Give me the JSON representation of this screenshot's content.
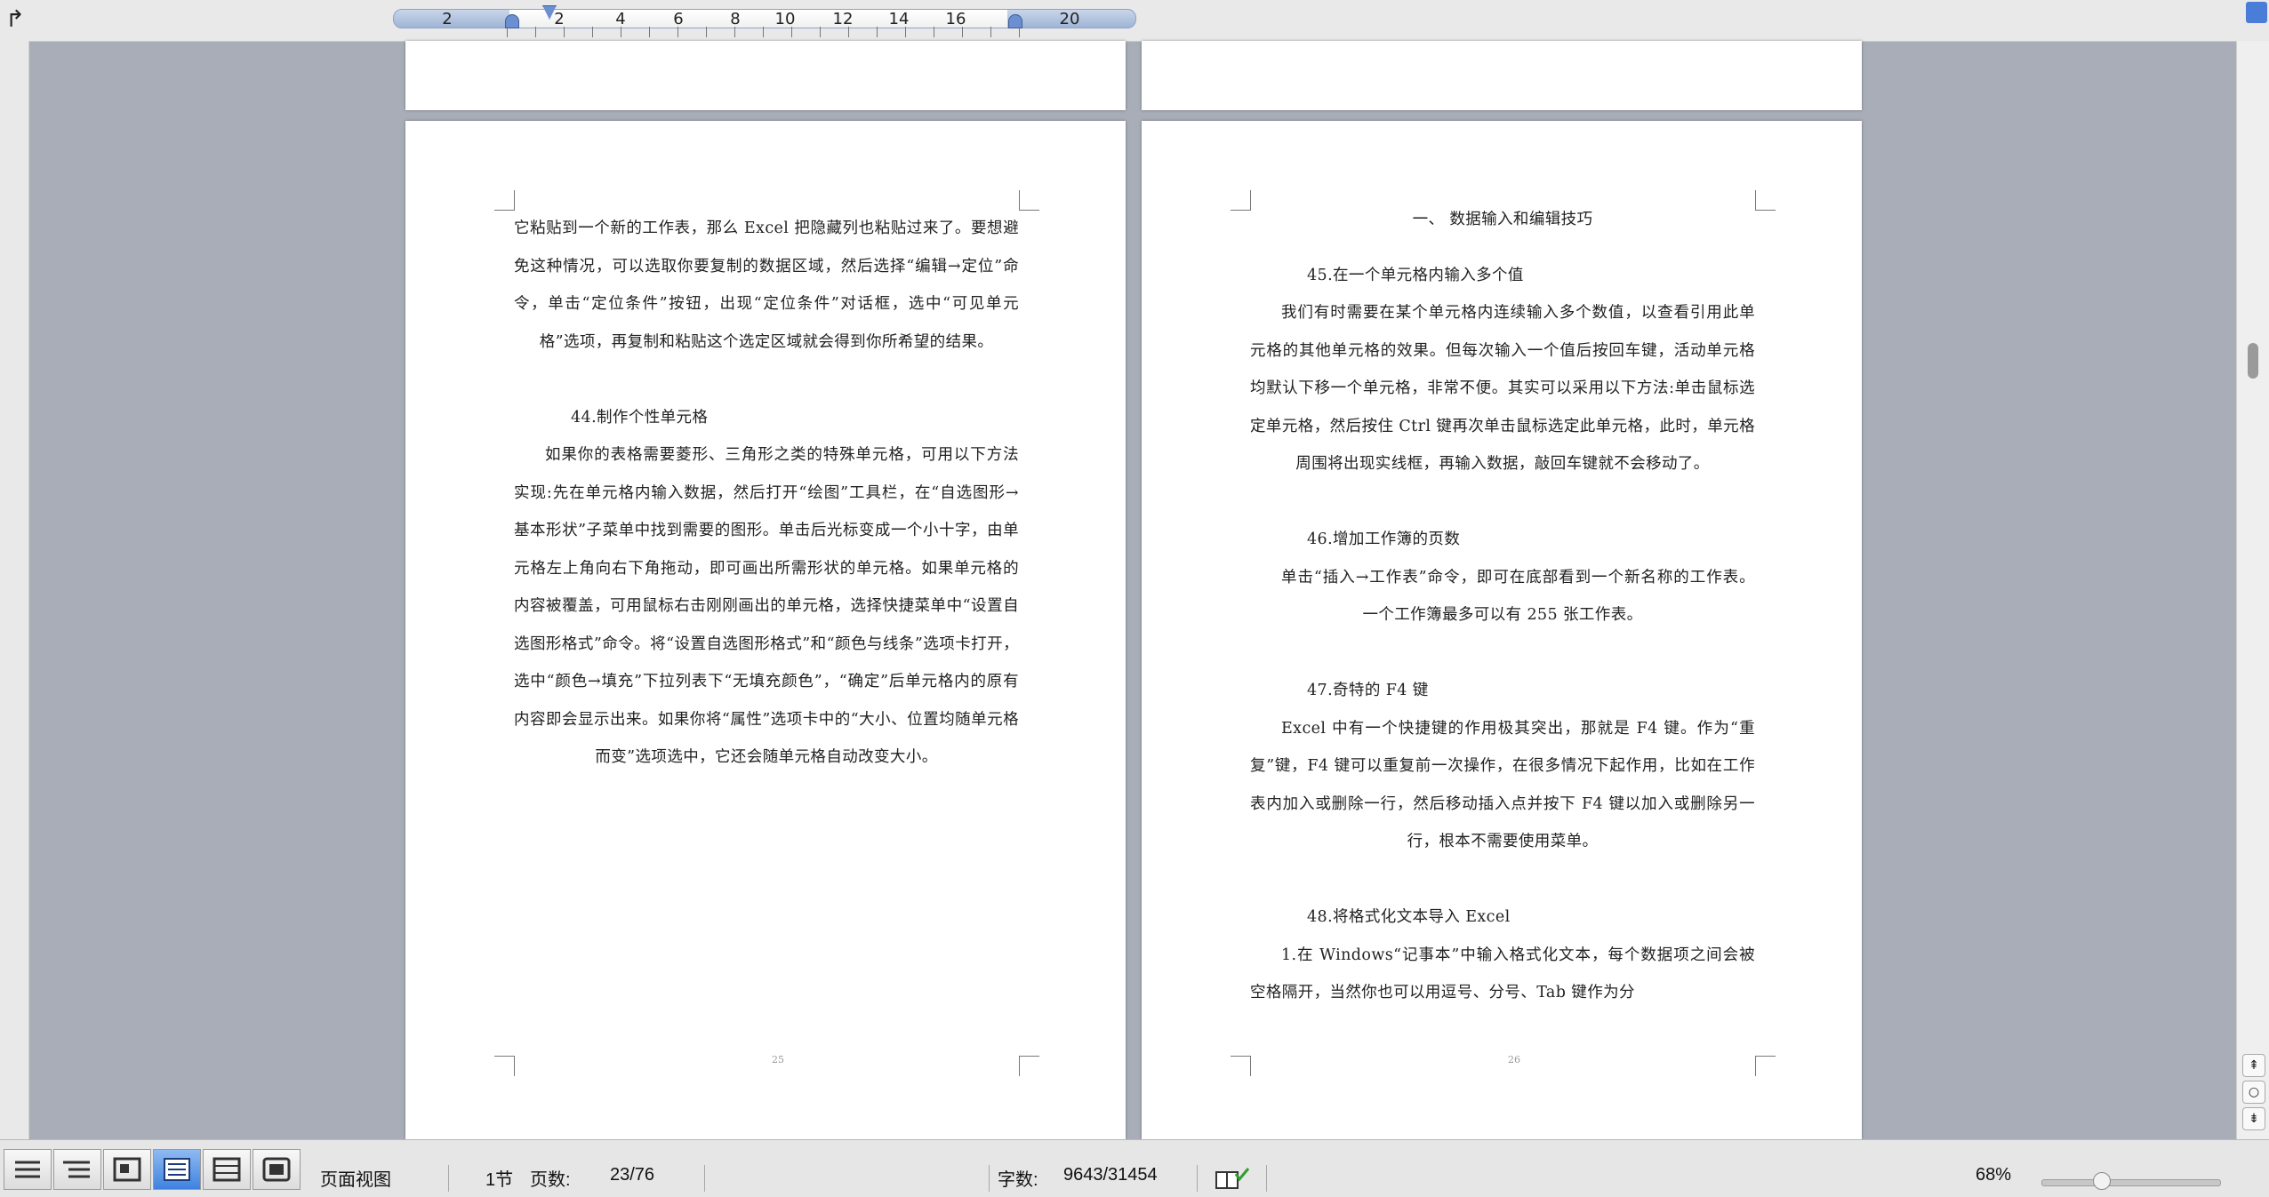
{
  "ruler": {
    "numbers": [
      "2",
      "2",
      "4",
      "6",
      "8",
      "10",
      "12",
      "14",
      "16",
      "20"
    ]
  },
  "left_page": {
    "paragraphs": [
      "它粘贴到一个新的工作表，那么 Excel 把隐藏列也粘贴过来了。要想避免这种情况，可以选取你要复制的数据区域，然后选择“编辑→定位”命令，单击“定位条件”按钮，出现“定位条件”对话框，选中“可见单元格”选项，再复制和粘贴这个选定区域就会得到你所希望的结果。",
      "如果你的表格需要菱形、三角形之类的特殊单元格，可用以下方法实现:先在单元格内输入数据，然后打开“绘图”工具栏，在“自选图形→基本形状”子菜单中找到需要的图形。单击后光标变成一个小十字，由单元格左上角向右下角拖动，即可画出所需形状的单元格。如果单元格的内容被覆盖，可用鼠标右击刚刚画出的单元格，选择快捷菜单中“设置自选图形格式”命令。将“设置自选图形格式”和“颜色与线条”选项卡打开，选中“颜色→填充”下拉列表下“无填充颜色”，“确定”后单元格内的原有内容即会显示出来。如果你将“属性”选项卡中的“大小、位置均随单元格而变”选项选中，它还会随单元格自动改变大小。"
    ],
    "heading_44": "44.制作个性单元格",
    "page_number": "25"
  },
  "right_page": {
    "section_title": "一、 数据输入和编辑技巧",
    "heading_45": "45.在一个单元格内输入多个值",
    "para_45": "我们有时需要在某个单元格内连续输入多个数值，以查看引用此单元格的其他单元格的效果。但每次输入一个值后按回车键，活动单元格均默认下移一个单元格，非常不便。其实可以采用以下方法:单击鼠标选定单元格，然后按住 Ctrl 键再次单击鼠标选定此单元格，此时，单元格周围将出现实线框，再输入数据，敲回车键就不会移动了。",
    "heading_46": "46.增加工作簿的页数",
    "para_46": "单击“插入→工作表”命令，即可在底部看到一个新名称的工作表。一个工作簿最多可以有 255 张工作表。",
    "heading_47": "47.奇特的 F4 键",
    "para_47": "Excel 中有一个快捷键的作用极其突出，那就是 F4 键。作为“重复”键，F4 键可以重复前一次操作，在很多情况下起作用，比如在工作表内加入或删除一行，然后移动插入点并按下 F4 键以加入或删除另一行，根本不需要使用菜单。",
    "heading_48": "48.将格式化文本导入 Excel",
    "para_48": "1.在 Windows“记事本”中输入格式化文本，每个数据项之间会被空格隔开，当然你也可以用逗号、分号、Tab 键作为分",
    "page_number": "26"
  },
  "status": {
    "view": "页面视图",
    "section": "1节",
    "pages_label": "页数:",
    "pages_value": "23/76",
    "words_label": "字数:",
    "words_value": "9643/31454",
    "zoom": "68%"
  }
}
